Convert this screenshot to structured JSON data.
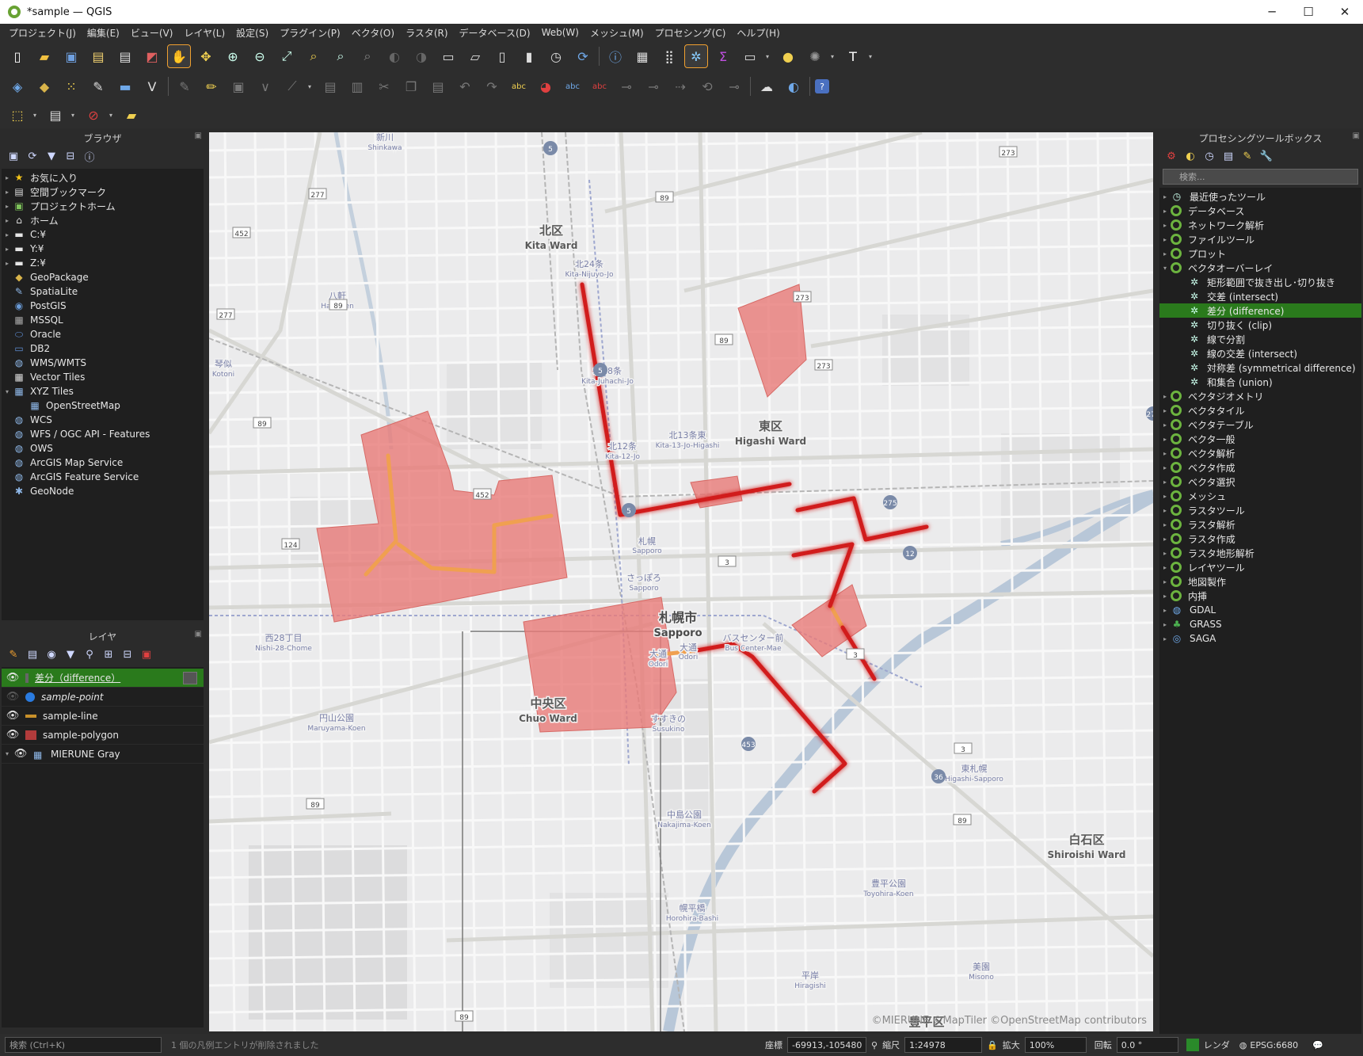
{
  "window": {
    "title": "*sample — QGIS",
    "minimize": "─",
    "maximize": "☐",
    "close": "✕"
  },
  "menu": [
    "プロジェクト(J)",
    "編集(E)",
    "ビュー(V)",
    "レイヤ(L)",
    "設定(S)",
    "プラグイン(P)",
    "ベクタ(O)",
    "ラスタ(R)",
    "データベース(D)",
    "Web(W)",
    "メッシュ(M)",
    "プロセシング(C)",
    "ヘルプ(H)"
  ],
  "browser": {
    "title": "ブラウザ",
    "items": [
      {
        "label": "お気に入り",
        "icon": "star-icon",
        "glyph": "★",
        "color": "#f5c518",
        "expand": "▸"
      },
      {
        "label": "空間ブックマーク",
        "icon": "bookmark-icon",
        "glyph": "▤",
        "color": "#dddddd",
        "expand": "▸"
      },
      {
        "label": "プロジェクトホーム",
        "icon": "project-home-icon",
        "glyph": "▣",
        "color": "#7ec35b",
        "expand": "▸"
      },
      {
        "label": "ホーム",
        "icon": "home-icon",
        "glyph": "⌂",
        "color": "#dddddd",
        "expand": "▸"
      },
      {
        "label": "C:¥",
        "icon": "folder-icon",
        "glyph": "▬",
        "color": "#e6e6e6",
        "expand": "▸"
      },
      {
        "label": "Y:¥",
        "icon": "folder-icon",
        "glyph": "▬",
        "color": "#e6e6e6",
        "expand": "▸"
      },
      {
        "label": "Z:¥",
        "icon": "folder-icon",
        "glyph": "▬",
        "color": "#e6e6e6",
        "expand": "▸"
      },
      {
        "label": "GeoPackage",
        "icon": "geopackage-icon",
        "glyph": "◆",
        "color": "#d9b44a",
        "expand": ""
      },
      {
        "label": "SpatiaLite",
        "icon": "spatialite-icon",
        "glyph": "✎",
        "color": "#8fb8e8",
        "expand": ""
      },
      {
        "label": "PostGIS",
        "icon": "postgis-icon",
        "glyph": "◉",
        "color": "#6a9bd8",
        "expand": ""
      },
      {
        "label": "MSSQL",
        "icon": "mssql-icon",
        "glyph": "▦",
        "color": "#aaaaaa",
        "expand": ""
      },
      {
        "label": "Oracle",
        "icon": "oracle-icon",
        "glyph": "⬭",
        "color": "#5f8fd6",
        "expand": ""
      },
      {
        "label": "DB2",
        "icon": "db2-icon",
        "glyph": "▭",
        "color": "#5f8fd6",
        "expand": ""
      },
      {
        "label": "WMS/WMTS",
        "icon": "wms-icon",
        "glyph": "◍",
        "color": "#8fb8e8",
        "expand": ""
      },
      {
        "label": "Vector Tiles",
        "icon": "vector-tiles-icon",
        "glyph": "▦",
        "color": "#dddddd",
        "expand": ""
      },
      {
        "label": "XYZ Tiles",
        "icon": "xyz-tiles-icon",
        "glyph": "▦",
        "color": "#8fb8e8",
        "expand": "▾"
      },
      {
        "label": "OpenStreetMap",
        "icon": "xyz-layer-icon",
        "glyph": "▦",
        "color": "#8fb8e8",
        "expand": "",
        "indent": true
      },
      {
        "label": "WCS",
        "icon": "wcs-icon",
        "glyph": "◍",
        "color": "#8fb8e8",
        "expand": ""
      },
      {
        "label": "WFS / OGC API - Features",
        "icon": "wfs-icon",
        "glyph": "◍",
        "color": "#8fb8e8",
        "expand": ""
      },
      {
        "label": "OWS",
        "icon": "ows-icon",
        "glyph": "◍",
        "color": "#8fb8e8",
        "expand": ""
      },
      {
        "label": "ArcGIS Map Service",
        "icon": "arcgis-map-icon",
        "glyph": "◍",
        "color": "#8fb8e8",
        "expand": ""
      },
      {
        "label": "ArcGIS Feature Service",
        "icon": "arcgis-feature-icon",
        "glyph": "◍",
        "color": "#8fb8e8",
        "expand": ""
      },
      {
        "label": "GeoNode",
        "icon": "geonode-icon",
        "glyph": "✱",
        "color": "#8fb8e8",
        "expand": ""
      }
    ]
  },
  "layers": {
    "title": "レイヤ",
    "items": [
      {
        "label": "差分（difference）",
        "checked": true,
        "symbol_color": "#888888",
        "selected": true
      },
      {
        "label": "sample-point",
        "checked": false,
        "symbol_color": "#2a7be0",
        "italic": true
      },
      {
        "label": "sample-line",
        "checked": true,
        "symbol_color": "#c8902a"
      },
      {
        "label": "sample-polygon",
        "checked": true,
        "symbol_color": "#b23b3b"
      },
      {
        "label": "MIERUNE Gray",
        "checked": true,
        "symbol_color": "#8fb8e8",
        "raster": true
      }
    ]
  },
  "toolbox": {
    "title": "プロセシングツールボックス",
    "search_placeholder": "検索...",
    "groups": [
      {
        "label": "最近使ったツール",
        "icon": "clock-icon",
        "expand": "▸"
      },
      {
        "label": "データベース",
        "icon": "qgis-icon",
        "expand": "▸"
      },
      {
        "label": "ネットワーク解析",
        "icon": "qgis-icon",
        "expand": "▸"
      },
      {
        "label": "ファイルツール",
        "icon": "qgis-icon",
        "expand": "▸"
      },
      {
        "label": "プロット",
        "icon": "qgis-icon",
        "expand": "▸"
      },
      {
        "label": "ベクタオーバーレイ",
        "icon": "qgis-icon",
        "expand": "▾"
      },
      {
        "label": "矩形範囲で抜き出し･切り抜き",
        "icon": "tool-icon",
        "child": true
      },
      {
        "label": "交差 (intersect)",
        "icon": "tool-icon",
        "child": true
      },
      {
        "label": "差分 (difference)",
        "icon": "tool-icon",
        "child": true,
        "selected": true
      },
      {
        "label": "切り抜く (clip)",
        "icon": "tool-icon",
        "child": true
      },
      {
        "label": "線で分割",
        "icon": "tool-icon",
        "child": true
      },
      {
        "label": "線の交差 (intersect)",
        "icon": "tool-icon",
        "child": true
      },
      {
        "label": "対称差 (symmetrical difference)",
        "icon": "tool-icon",
        "child": true
      },
      {
        "label": "和集合 (union)",
        "icon": "tool-icon",
        "child": true
      },
      {
        "label": "ベクタジオメトリ",
        "icon": "qgis-icon",
        "expand": "▸"
      },
      {
        "label": "ベクタタイル",
        "icon": "qgis-icon",
        "expand": "▸"
      },
      {
        "label": "ベクタテーブル",
        "icon": "qgis-icon",
        "expand": "▸"
      },
      {
        "label": "ベクタ一般",
        "icon": "qgis-icon",
        "expand": "▸"
      },
      {
        "label": "ベクタ解析",
        "icon": "qgis-icon",
        "expand": "▸"
      },
      {
        "label": "ベクタ作成",
        "icon": "qgis-icon",
        "expand": "▸"
      },
      {
        "label": "ベクタ選択",
        "icon": "qgis-icon",
        "expand": "▸"
      },
      {
        "label": "メッシュ",
        "icon": "qgis-icon",
        "expand": "▸"
      },
      {
        "label": "ラスタツール",
        "icon": "qgis-icon",
        "expand": "▸"
      },
      {
        "label": "ラスタ解析",
        "icon": "qgis-icon",
        "expand": "▸"
      },
      {
        "label": "ラスタ作成",
        "icon": "qgis-icon",
        "expand": "▸"
      },
      {
        "label": "ラスタ地形解析",
        "icon": "qgis-icon",
        "expand": "▸"
      },
      {
        "label": "レイヤツール",
        "icon": "qgis-icon",
        "expand": "▸"
      },
      {
        "label": "地図製作",
        "icon": "qgis-icon",
        "expand": "▸"
      },
      {
        "label": "内挿",
        "icon": "qgis-icon",
        "expand": "▸"
      },
      {
        "label": "GDAL",
        "icon": "gdal-icon",
        "expand": "▸"
      },
      {
        "label": "GRASS",
        "icon": "grass-icon",
        "expand": "▸"
      },
      {
        "label": "SAGA",
        "icon": "saga-icon",
        "expand": "▸"
      }
    ]
  },
  "map": {
    "attribution": "©MIERUNE ©MapTiler ©OpenStreetMap contributors",
    "labels": [
      {
        "id": "kita-ja",
        "text": "北区",
        "cls": "big"
      },
      {
        "id": "kita-en",
        "text": "Kita Ward",
        "cls": "bigen"
      },
      {
        "id": "higashi-ja",
        "text": "東区",
        "cls": "big"
      },
      {
        "id": "higashi-en",
        "text": "Higashi Ward",
        "cls": "bigen"
      },
      {
        "id": "chuo-ja",
        "text": "中央区",
        "cls": "big"
      },
      {
        "id": "chuo-en",
        "text": "Chuo Ward",
        "cls": "bigen"
      },
      {
        "id": "shiroishi-ja",
        "text": "白石区",
        "cls": "big"
      },
      {
        "id": "shiroishi-en",
        "text": "Shiroishi Ward",
        "cls": "bigen"
      },
      {
        "id": "sapporo-ja",
        "text": "札幌市",
        "cls": "city"
      },
      {
        "id": "sapporo-en",
        "text": "Sapporo",
        "cls": "cityen"
      },
      {
        "id": "shinkawa",
        "text": "新川",
        "cls": "st"
      },
      {
        "id": "shinkawa-en",
        "text": "Shinkawa",
        "cls": "sten"
      },
      {
        "id": "kita24",
        "text": "北24条",
        "cls": "st"
      },
      {
        "id": "kita24-en",
        "text": "Kita-Nijuyo-Jo",
        "cls": "sten"
      },
      {
        "id": "kita18",
        "text": "北18条",
        "cls": "st"
      },
      {
        "id": "kita18-en",
        "text": "Kita-Juhachi-Jo",
        "cls": "sten"
      },
      {
        "id": "kita12",
        "text": "北12条",
        "cls": "st"
      },
      {
        "id": "kita12-en",
        "text": "Kita-12-Jo",
        "cls": "sten"
      },
      {
        "id": "kita13h",
        "text": "北13条東",
        "cls": "st"
      },
      {
        "id": "kita13h-en",
        "text": "Kita-13-Jo-Higashi",
        "cls": "sten"
      },
      {
        "id": "hachiken",
        "text": "八軒",
        "cls": "st"
      },
      {
        "id": "hachiken-en",
        "text": "Hachiken",
        "cls": "sten"
      },
      {
        "id": "kotoni",
        "text": "琴似",
        "cls": "st"
      },
      {
        "id": "kotoni-en",
        "text": "Kotoni",
        "cls": "sten"
      },
      {
        "id": "sapporo-st",
        "text": "札幌",
        "cls": "st"
      },
      {
        "id": "sapporo-st-en",
        "text": "Sapporo",
        "cls": "sten"
      },
      {
        "id": "sapporo-st2",
        "text": "さっぽろ",
        "cls": "st"
      },
      {
        "id": "sapporo-st2-en",
        "text": "Sapporo",
        "cls": "sten"
      },
      {
        "id": "nishi28",
        "text": "西28丁目",
        "cls": "st"
      },
      {
        "id": "nishi28-en",
        "text": "Nishi-28-Chome",
        "cls": "sten"
      },
      {
        "id": "odori",
        "text": "大通",
        "cls": "st"
      },
      {
        "id": "odori-en",
        "text": "Odori",
        "cls": "sten"
      },
      {
        "id": "odori2",
        "text": "大通",
        "cls": "st"
      },
      {
        "id": "odori2-en",
        "text": "Odori",
        "cls": "sten"
      },
      {
        "id": "buscenter",
        "text": "バスセンター前",
        "cls": "st"
      },
      {
        "id": "buscenter-en",
        "text": "Bus Center-Mae",
        "cls": "sten"
      },
      {
        "id": "maruyama",
        "text": "円山公園",
        "cls": "st"
      },
      {
        "id": "maruyama-en",
        "text": "Maruyama-Koen",
        "cls": "sten"
      },
      {
        "id": "susukino",
        "text": "すすきの",
        "cls": "st"
      },
      {
        "id": "susukino-en",
        "text": "Susukino",
        "cls": "sten"
      },
      {
        "id": "nakajima",
        "text": "中島公園",
        "cls": "st"
      },
      {
        "id": "nakajima-en",
        "text": "Nakajima-Koen",
        "cls": "sten"
      },
      {
        "id": "higashisapporo",
        "text": "東札幌",
        "cls": "st"
      },
      {
        "id": "higashisapporo-en",
        "text": "Higashi-Sapporo",
        "cls": "sten"
      },
      {
        "id": "toyohira",
        "text": "豊平公園",
        "cls": "st"
      },
      {
        "id": "toyohira-en",
        "text": "Toyohira-Koen",
        "cls": "sten"
      },
      {
        "id": "horohira",
        "text": "幌平橋",
        "cls": "st"
      },
      {
        "id": "horohira-en",
        "text": "Horohira-Bashi",
        "cls": "sten"
      },
      {
        "id": "hiragishi",
        "text": "平岸",
        "cls": "st"
      },
      {
        "id": "hiragishi-en",
        "text": "Hiragishi",
        "cls": "sten"
      },
      {
        "id": "misono",
        "text": "美園",
        "cls": "st"
      },
      {
        "id": "misono-en",
        "text": "Misono",
        "cls": "sten"
      },
      {
        "id": "toyohira-ku",
        "text": "豊平区",
        "cls": "big"
      }
    ],
    "shields": [
      "5",
      "5",
      "5",
      "277",
      "452",
      "277",
      "89",
      "89",
      "89",
      "89",
      "89",
      "89",
      "89",
      "273",
      "273",
      "273",
      "275",
      "275",
      "12",
      "3",
      "3",
      "3",
      "124",
      "452",
      "453",
      "36"
    ]
  },
  "status": {
    "search_placeholder": "検索 (Ctrl+K)",
    "message": "1 個の凡例エントリが削除されました",
    "coord_label": "座標",
    "coord_value": "-69913,-105480",
    "scale_label": "縮尺",
    "scale_value": "1:24978",
    "magnifier_label": "拡大",
    "magnifier_value": "100%",
    "rotation_label": "回転",
    "rotation_value": "0.0 °",
    "render_label": "レンダ",
    "crs": "EPSG:6680"
  },
  "colors": {
    "poly_fill": "#e87a78",
    "poly_stroke": "#d76a66",
    "line_red": "#d11a1a",
    "line_orange": "#f0a050",
    "selected": "#2a7a1c"
  }
}
